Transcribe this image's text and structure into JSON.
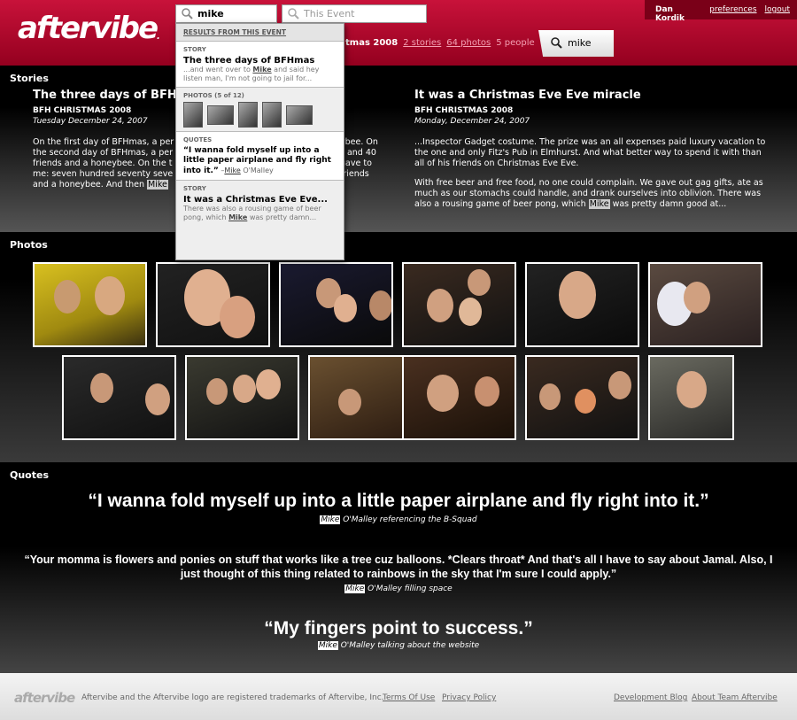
{
  "header": {
    "logo": "aftervibe",
    "logo_mark": ".",
    "user_name": "Dan Kordik",
    "preferences_link": "preferences",
    "logout_link": "logout",
    "search_value": "mike",
    "event_search_placeholder": "This Event",
    "event_title_partial": "tmas 2008",
    "stories_count": "2 stories",
    "photos_count": "64 photos",
    "people_count": "5 people",
    "active_search_tab": "mike"
  },
  "dropdown": {
    "heading": "RESULTS FROM THIS EVENT",
    "story1": {
      "category": "STORY",
      "title": "The three days of BFHmas",
      "snippet_pre": "...and went over to ",
      "snippet_hl": "Mike",
      "snippet_post": " and said hey listen man, I'm not going to jail for..."
    },
    "photos": {
      "category": "PHOTOS (5 of 12)"
    },
    "quotes": {
      "category": "QUOTES",
      "text": "“I wanna fold myself up into a little paper airplane and fly right into it.”",
      "by_pre": " –",
      "by_hl": "Mike",
      "by_post": " O'Malley"
    },
    "story2": {
      "category": "STORY",
      "title": "It was a Christmas Eve Eve...",
      "snippet_pre": "There was also a rousing game of beer pong, which ",
      "snippet_hl": "Mike",
      "snippet_post": " was pretty damn..."
    }
  },
  "stories": {
    "label": "Stories",
    "left": {
      "title": "The three days of BFHmas",
      "event": "BFH CHRISTMAS 2008",
      "date": "Tuesday December 24, 2007",
      "line1": "On the first day of BFHmas, a per",
      "line1b": "ybee. On",
      "line2": "the second day of BFHmas, a per",
      "line2b": "s and 40",
      "line3": "friends and a honeybee. On the t",
      "line3b": "gave to",
      "line4": "me: seven hundred seventy seve",
      "line4b": "friends",
      "line5": "and a honeybee. And then ",
      "hl": "Mike"
    },
    "right": {
      "title": "It was a Christmas Eve Eve miracle",
      "event": "BFH CHRISTMAS 2008",
      "date": "Monday, December 24, 2007",
      "p1": "...Inspector Gadget costume.  The prize was an all expenses paid luxury vacation to the one and only Fitz's Pub in Elmhurst.  And what better way to spend it with than all of his friends on Christmas Eve Eve.",
      "p2_pre": "With free beer and free food, no one could complain. We gave out gag gifts, ate as much as our stomachs could handle, and drank ourselves into oblivion.  There was also a rousing game of beer pong, which ",
      "p2_hl": "Mike",
      "p2_post": " was pretty damn good at..."
    }
  },
  "photos": {
    "label": "Photos"
  },
  "quotes": {
    "label": "Quotes",
    "items": [
      {
        "text": "“I wanna fold myself up into a little paper airplane and fly right into it.”",
        "hl": "Mike",
        "by": " O'Malley referencing the B-Squad"
      },
      {
        "text": "“Your momma is flowers and ponies on stuff that works like a tree cuz balloons. *Clears throat* And that's all I have to say about Jamal. Also, I just thought of this thing related to rainbows in the sky that I'm sure I could apply.”",
        "hl": "Mike",
        "by": " O'Malley filling space"
      },
      {
        "text": "“My fingers point to success.”",
        "hl": "Mike",
        "by": " O'Malley talking about the website"
      }
    ]
  },
  "footer": {
    "logo": "aftervibe",
    "trademark": "Aftervibe and the Aftervibe logo are registered trademarks of Aftervibe, Inc.",
    "terms": "Terms Of Use",
    "privacy": "Privacy Policy",
    "blog": "Development Blog",
    "about": "About Team Aftervibe"
  },
  "colors": {
    "brand_red": "#c8123a",
    "dark_red": "#94001f",
    "link_pink": "#f3a0b3"
  }
}
